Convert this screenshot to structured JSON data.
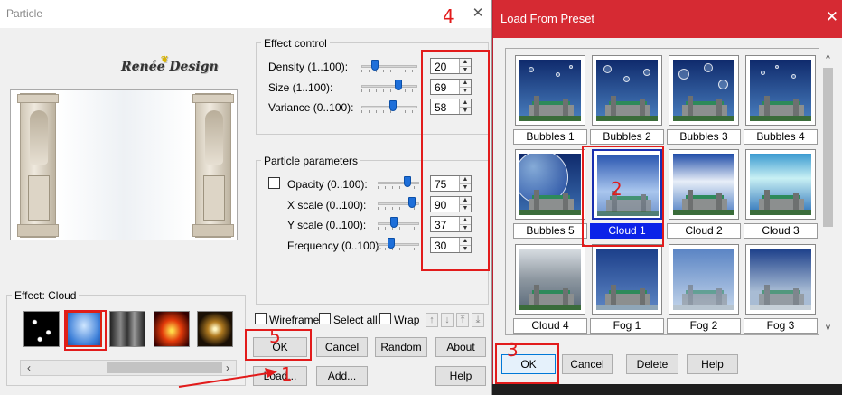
{
  "particle": {
    "title": "Particle",
    "logo": "Renée Design",
    "effect": {
      "label": "Effect: Cloud"
    },
    "effect_control": {
      "legend": "Effect control",
      "params": [
        {
          "label": "Density (1..100):",
          "value": "20",
          "level": 20
        },
        {
          "label": "Size (1..100):",
          "value": "69",
          "level": 69
        },
        {
          "label": "Variance (0..100):",
          "value": "58",
          "level": 58
        }
      ]
    },
    "particle_params": {
      "legend": "Particle parameters",
      "params": [
        {
          "label": "Opacity (0..100):",
          "value": "75",
          "level": 75
        },
        {
          "label": "X scale (0..100):",
          "value": "90",
          "level": 90
        },
        {
          "label": "Y scale (0..100):",
          "value": "37",
          "level": 37
        },
        {
          "label": "Frequency (0..100):",
          "value": "30",
          "level": 30
        }
      ]
    },
    "options": {
      "wireframe": "Wireframe",
      "select_all": "Select all",
      "wrap": "Wrap"
    },
    "buttons": {
      "ok": "OK",
      "cancel": "Cancel",
      "random": "Random",
      "about": "About",
      "load": "Load...",
      "add": "Add...",
      "help": "Help"
    }
  },
  "preset": {
    "title": "Load From Preset",
    "items": [
      "Bubbles 1",
      "Bubbles 2",
      "Bubbles 3",
      "Bubbles 4",
      "Bubbles 5",
      "Cloud 1",
      "Cloud 2",
      "Cloud 3",
      "Cloud 4",
      "Fog 1",
      "Fog 2",
      "Fog 3"
    ],
    "selected": "Cloud 1",
    "buttons": {
      "ok": "OK",
      "cancel": "Cancel",
      "delete": "Delete",
      "help": "Help"
    }
  },
  "annotations": {
    "n1": "1",
    "n2": "2",
    "n3": "3",
    "n4": "4",
    "n5": "5"
  },
  "colors": {
    "annotation": "#e21b1b",
    "selection": "#0b23e8",
    "preset_titlebar": "#d62a33",
    "slider_knob": "#1e6fd9"
  }
}
